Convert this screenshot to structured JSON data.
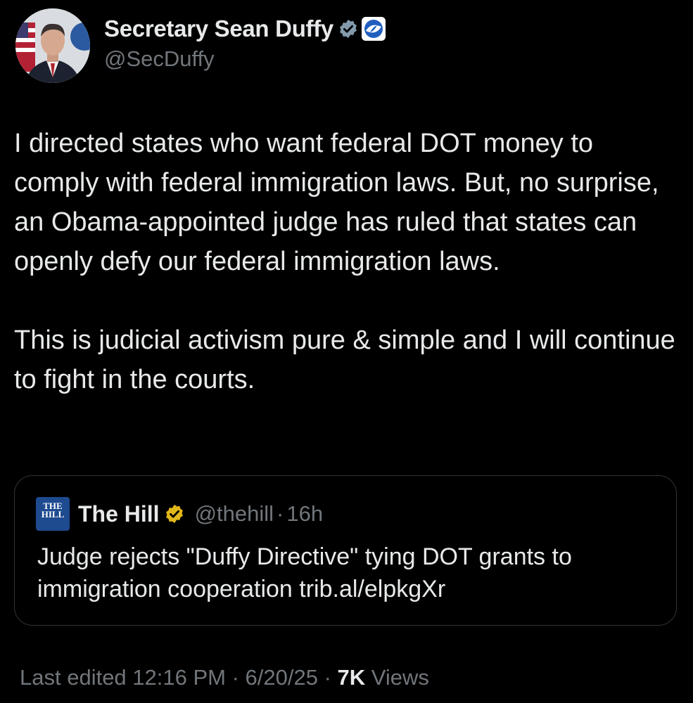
{
  "author": {
    "display_name": "Secretary Sean Duffy",
    "handle": "@SecDuffy",
    "verified_badge_color": "#829aab",
    "affiliation_badge_color": "#1f5fbf"
  },
  "tweet": {
    "paragraphs": [
      "I directed states who want federal DOT money to comply with federal immigration laws. But, no surprise, an Obama-appointed judge has ruled that states can openly defy our federal immigration laws.",
      "This is judicial activism pure & simple and I will continue to fight in the courts."
    ]
  },
  "quoted": {
    "logo_text_line1": "THE",
    "logo_text_line2": "HILL",
    "name": "The Hill",
    "handle": "@thehill",
    "separator": "·",
    "time": "16h",
    "text": "Judge rejects \"Duffy Directive\" tying DOT grants to immigration cooperation trib.al/elpkgXr",
    "verified_badge_color": "#e2b719"
  },
  "footer": {
    "edited_label": "Last edited 12:16 PM · 6/20/25",
    "separator": "·",
    "views_count": "7K",
    "views_label": "Views"
  }
}
